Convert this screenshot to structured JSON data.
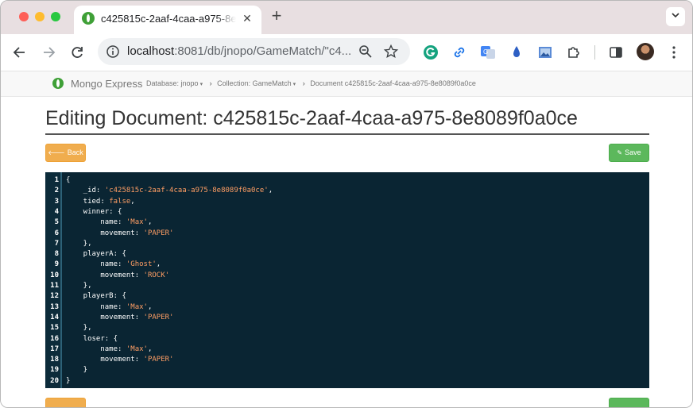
{
  "browser": {
    "tab_title": "c425815c-2aaf-4caa-a975-8e8089f0a0ce",
    "url_host": "localhost",
    "url_rest": ":8081/db/jnopo/GameMatch/\"c4..."
  },
  "navbar": {
    "brand": "Mongo Express",
    "crumbs": [
      {
        "label": "Database: jnopo"
      },
      {
        "label": "Collection: GameMatch"
      },
      {
        "label": "Document c425815c-2aaf-4caa-a975-8e8089f0a0ce"
      }
    ]
  },
  "main": {
    "heading": "Editing Document: c425815c-2aaf-4caa-a975-8e8089f0a0ce",
    "back_label": "Back",
    "save_label": "Save"
  },
  "editor": {
    "lines": [
      [
        {
          "t": "{"
        }
      ],
      [
        {
          "t": "    _id: "
        },
        {
          "t": "'c425815c-2aaf-4caa-a975-8e8089f0a0ce'",
          "k": "str"
        },
        {
          "t": ","
        }
      ],
      [
        {
          "t": "    tied: "
        },
        {
          "t": "false",
          "k": "bool"
        },
        {
          "t": ","
        }
      ],
      [
        {
          "t": "    winner: {"
        }
      ],
      [
        {
          "t": "        name: "
        },
        {
          "t": "'Max'",
          "k": "str"
        },
        {
          "t": ","
        }
      ],
      [
        {
          "t": "        movement: "
        },
        {
          "t": "'PAPER'",
          "k": "str"
        }
      ],
      [
        {
          "t": "    },"
        }
      ],
      [
        {
          "t": "    playerA: {"
        }
      ],
      [
        {
          "t": "        name: "
        },
        {
          "t": "'Ghost'",
          "k": "str"
        },
        {
          "t": ","
        }
      ],
      [
        {
          "t": "        movement: "
        },
        {
          "t": "'ROCK'",
          "k": "str"
        }
      ],
      [
        {
          "t": "    },"
        }
      ],
      [
        {
          "t": "    playerB: {"
        }
      ],
      [
        {
          "t": "        name: "
        },
        {
          "t": "'Max'",
          "k": "str"
        },
        {
          "t": ","
        }
      ],
      [
        {
          "t": "        movement: "
        },
        {
          "t": "'PAPER'",
          "k": "str"
        }
      ],
      [
        {
          "t": "    },"
        }
      ],
      [
        {
          "t": "    loser: {"
        }
      ],
      [
        {
          "t": "        name: "
        },
        {
          "t": "'Max'",
          "k": "str"
        },
        {
          "t": ","
        }
      ],
      [
        {
          "t": "        movement: "
        },
        {
          "t": "'PAPER'",
          "k": "str"
        }
      ],
      [
        {
          "t": "    }"
        }
      ],
      [
        {
          "t": "}"
        }
      ]
    ]
  },
  "colors": {
    "editor_bg": "#0a2533",
    "string": "#ff9e64",
    "back_button": "#f0ad4e",
    "save_button": "#5cb85c",
    "brand_green": "#3fa037"
  },
  "icons": {
    "tab_favicon": "mongodb-leaf-icon",
    "tab_close": "close-icon",
    "new_tab": "plus-icon",
    "back_nav": "arrow-left-icon",
    "forward_nav": "arrow-right-icon",
    "reload": "reload-icon",
    "site_info": "info-icon",
    "zoom": "zoom-out-icon",
    "bookmark": "star-icon",
    "back_button": "arrow-left-icon",
    "save_button": "pencil-icon"
  }
}
